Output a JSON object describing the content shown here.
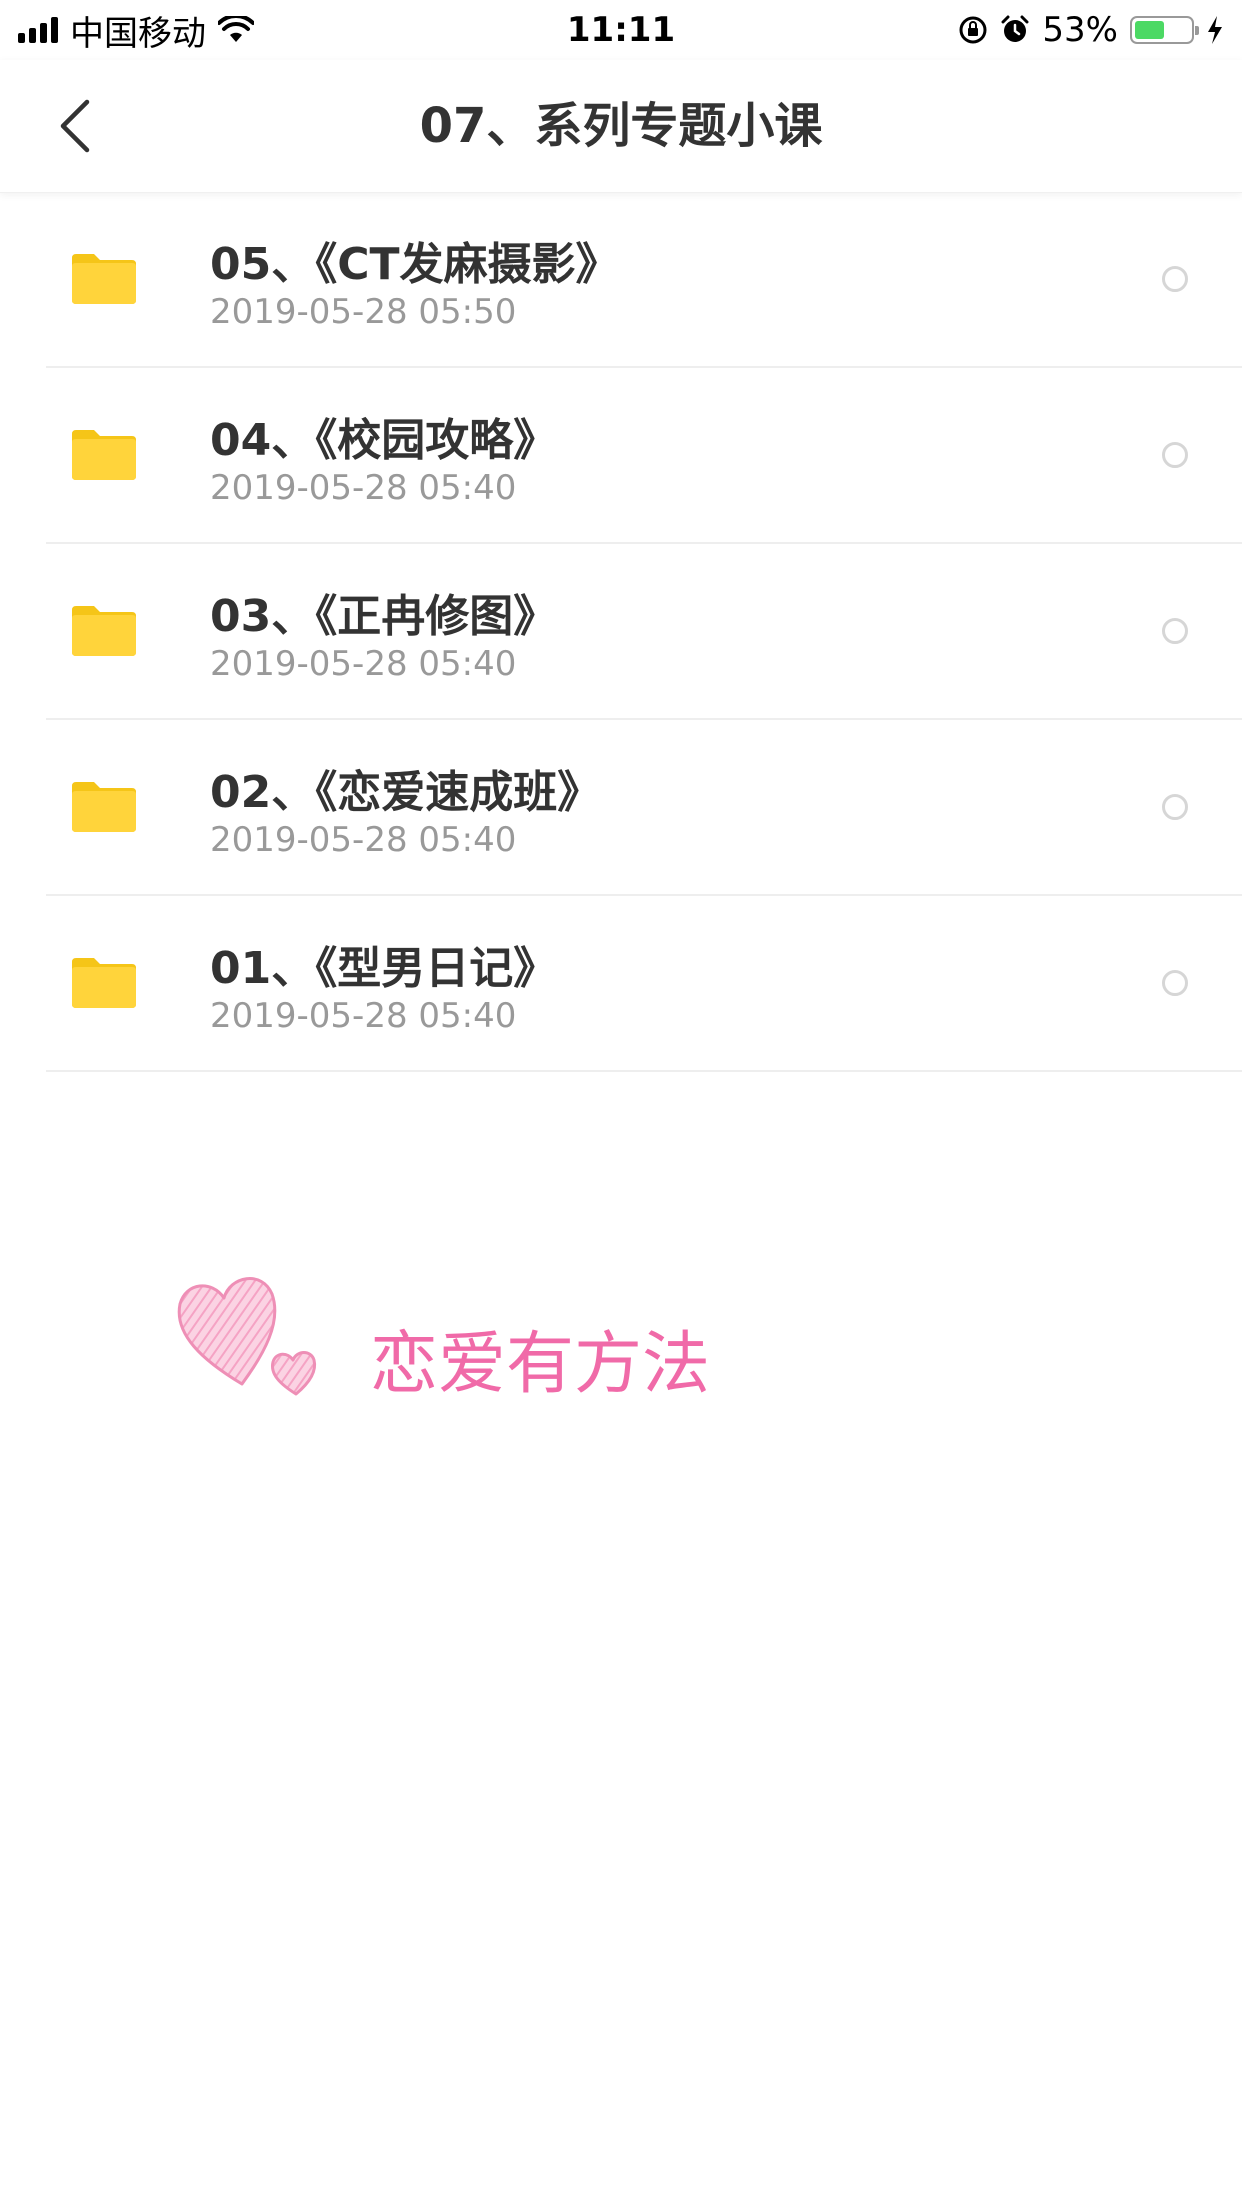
{
  "status_bar": {
    "carrier": "中国移动",
    "time": "11:11",
    "battery_percent": "53%",
    "battery_level": 0.53,
    "battery_color": "#4cd964",
    "icons": [
      "signal-icon",
      "wifi-icon",
      "rotation-lock-icon",
      "alarm-icon",
      "battery-icon",
      "charging-icon"
    ]
  },
  "nav": {
    "title": "07、系列专题小课",
    "back_icon": "chevron-left-icon"
  },
  "files": [
    {
      "name": "05、《CT发麻摄影》",
      "date": "2019-05-28 05:50"
    },
    {
      "name": "04、《校园攻略》",
      "date": "2019-05-28 05:40"
    },
    {
      "name": "03、《正冉修图》",
      "date": "2019-05-28 05:40"
    },
    {
      "name": "02、《恋爱速成班》",
      "date": "2019-05-28 05:40"
    },
    {
      "name": "01、《型男日记》",
      "date": "2019-05-28 05:40"
    }
  ],
  "folder_color": "#ffd02f",
  "watermark": {
    "text": "恋爱有方法",
    "color": "#f06aa8"
  }
}
